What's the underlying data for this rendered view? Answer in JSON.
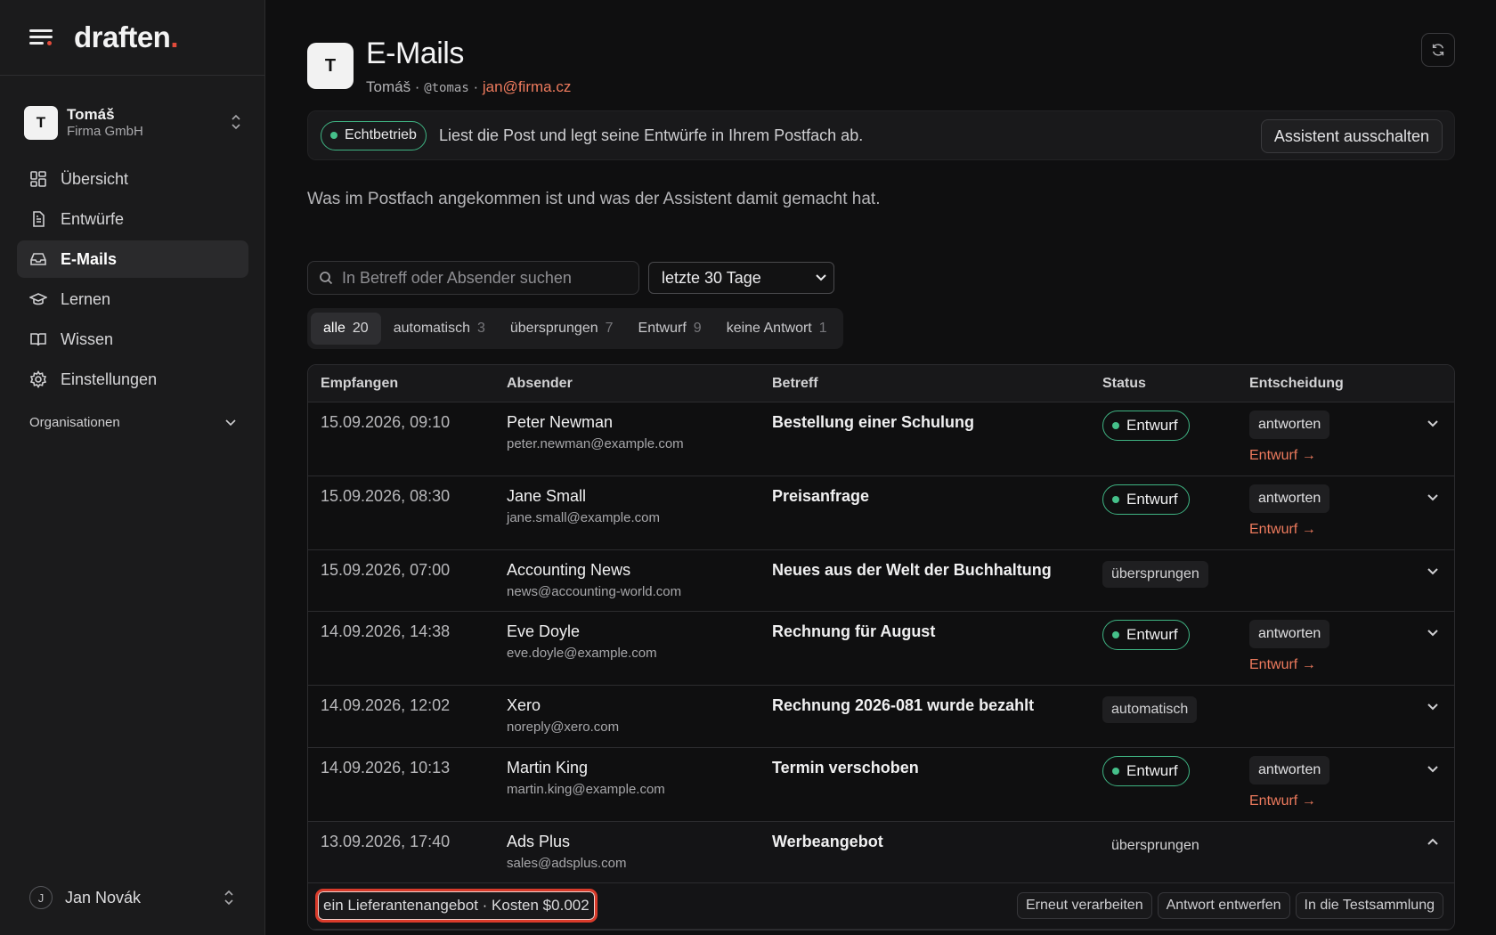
{
  "brand": {
    "name": "draften",
    "dot": "."
  },
  "tenant": {
    "initial": "T",
    "name": "Tomáš",
    "company": "Firma GmbH"
  },
  "nav": [
    {
      "label": "Übersicht",
      "icon": "grid-icon",
      "active": false
    },
    {
      "label": "Entwürfe",
      "icon": "document-icon",
      "active": false
    },
    {
      "label": "E-Mails",
      "icon": "inbox-icon",
      "active": true
    },
    {
      "label": "Lernen",
      "icon": "graduation-cap-icon",
      "active": false
    },
    {
      "label": "Wissen",
      "icon": "book-icon",
      "active": false
    },
    {
      "label": "Einstellungen",
      "icon": "gear-icon",
      "active": false
    }
  ],
  "orgs_label": "Organisationen",
  "user": {
    "initial": "J",
    "name": "Jan Novák"
  },
  "header": {
    "initial": "T",
    "title": "E-Mails",
    "name": "Tomáš",
    "sep": " · ",
    "handle": "@tomas",
    "email": "jan@firma.cz"
  },
  "banner": {
    "status": "Echtbetrieb",
    "text": "Liest die Post und legt seine Entwürfe in Ihrem Postfach ab.",
    "button": "Assistent ausschalten"
  },
  "description": "Was im Postfach angekommen ist und was der Assistent damit gemacht hat.",
  "search": {
    "placeholder": "In Betreff oder Absender suchen"
  },
  "range": {
    "selected": "letzte 30 Tage"
  },
  "filters": [
    {
      "label": "alle",
      "count": "20",
      "active": true
    },
    {
      "label": "automatisch",
      "count": "3",
      "active": false
    },
    {
      "label": "übersprungen",
      "count": "7",
      "active": false
    },
    {
      "label": "Entwurf",
      "count": "9",
      "active": false
    },
    {
      "label": "keine Antwort",
      "count": "1",
      "active": false
    }
  ],
  "table": {
    "headers": [
      "Empfangen",
      "Absender",
      "Betreff",
      "Status",
      "Entscheidung"
    ],
    "rows": [
      {
        "date": "15.09.2026, 09:10",
        "name": "Peter Newman",
        "email": "peter.newman@example.com",
        "subject": "Bestellung einer Schulung",
        "status": "Entwurf",
        "decision": "antworten",
        "link": "Entwurf →"
      },
      {
        "date": "15.09.2026, 08:30",
        "name": "Jane Small",
        "email": "jane.small@example.com",
        "subject": "Preisanfrage",
        "status": "Entwurf",
        "decision": "antworten",
        "link": "Entwurf →"
      },
      {
        "date": "15.09.2026, 07:00",
        "name": "Accounting News",
        "email": "news@accounting-world.com",
        "subject": "Neues aus der Welt der Buchhaltung",
        "status": "übersprungen",
        "decision": "",
        "link": ""
      },
      {
        "date": "14.09.2026, 14:38",
        "name": "Eve Doyle",
        "email": "eve.doyle@example.com",
        "subject": "Rechnung für August",
        "status": "Entwurf",
        "decision": "antworten",
        "link": "Entwurf →"
      },
      {
        "date": "14.09.2026, 12:02",
        "name": "Xero",
        "email": "noreply@xero.com",
        "subject": "Rechnung 2026-081 wurde bezahlt",
        "status": "automatisch",
        "decision": "",
        "link": ""
      },
      {
        "date": "14.09.2026, 10:13",
        "name": "Martin King",
        "email": "martin.king@example.com",
        "subject": "Termin verschoben",
        "status": "Entwurf",
        "decision": "antworten",
        "link": "Entwurf →"
      },
      {
        "date": "13.09.2026, 17:40",
        "name": "Ads Plus",
        "email": "sales@adsplus.com",
        "subject": "Werbeangebot",
        "status": "übersprungen",
        "decision": "",
        "link": ""
      }
    ],
    "detail": {
      "summary": "ein Lieferantenangebot · Kosten $0.002",
      "actions": [
        "Erneut verarbeiten",
        "Antwort entwerfen",
        "In die Testsammlung"
      ]
    }
  },
  "colors": {
    "accent": "#ec7a5d",
    "brand_dot": "#e24b3b",
    "status_green": "#3fb483",
    "highlight": "#d93b2b"
  }
}
